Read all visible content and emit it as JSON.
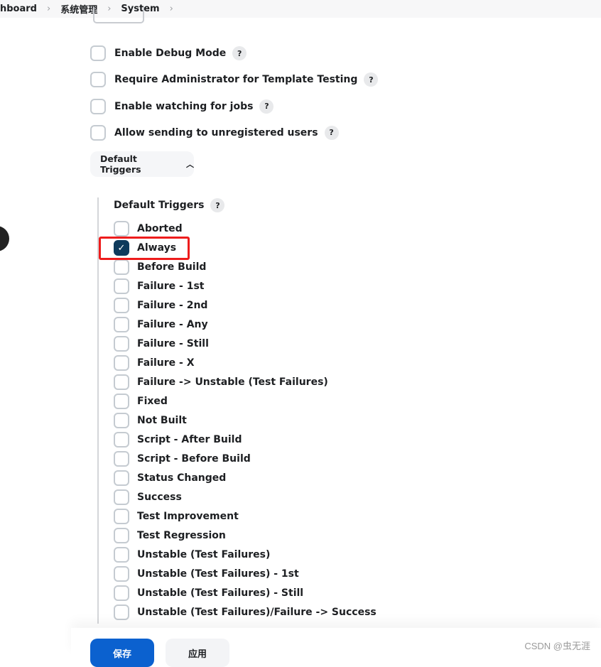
{
  "breadcrumb": [
    "hboard",
    "系统管理",
    "System"
  ],
  "options": [
    {
      "label": "Enable Debug Mode",
      "checked": false
    },
    {
      "label": "Require Administrator for Template Testing",
      "checked": false
    },
    {
      "label": "Enable watching for jobs",
      "checked": false
    },
    {
      "label": "Allow sending to unregistered users",
      "checked": false
    }
  ],
  "help_glyph": "?",
  "section_toggle": {
    "label": "Default Triggers",
    "icon": "chevron-up-icon",
    "expanded": true
  },
  "triggers_label": "Default Triggers",
  "triggers": [
    {
      "label": "Aborted",
      "checked": false
    },
    {
      "label": "Always",
      "checked": true
    },
    {
      "label": "Before Build",
      "checked": false
    },
    {
      "label": "Failure - 1st",
      "checked": false
    },
    {
      "label": "Failure - 2nd",
      "checked": false
    },
    {
      "label": "Failure - Any",
      "checked": false
    },
    {
      "label": "Failure - Still",
      "checked": false
    },
    {
      "label": "Failure - X",
      "checked": false
    },
    {
      "label": "Failure -> Unstable (Test Failures)",
      "checked": false
    },
    {
      "label": "Fixed",
      "checked": false
    },
    {
      "label": "Not Built",
      "checked": false
    },
    {
      "label": "Script - After Build",
      "checked": false
    },
    {
      "label": "Script - Before Build",
      "checked": false
    },
    {
      "label": "Status Changed",
      "checked": false
    },
    {
      "label": "Success",
      "checked": false
    },
    {
      "label": "Test Improvement",
      "checked": false
    },
    {
      "label": "Test Regression",
      "checked": false
    },
    {
      "label": "Unstable (Test Failures)",
      "checked": false
    },
    {
      "label": "Unstable (Test Failures) - 1st",
      "checked": false
    },
    {
      "label": "Unstable (Test Failures) - Still",
      "checked": false
    },
    {
      "label": "Unstable (Test Failures)/Failure -> Success",
      "checked": false
    }
  ],
  "buttons": {
    "save": "保存",
    "apply": "应用"
  },
  "watermark": "CSDN @虫无涯",
  "colors": {
    "primary": "#0b61cf",
    "checked": "#0e3a5c",
    "highlight": "#ee1c1c"
  }
}
